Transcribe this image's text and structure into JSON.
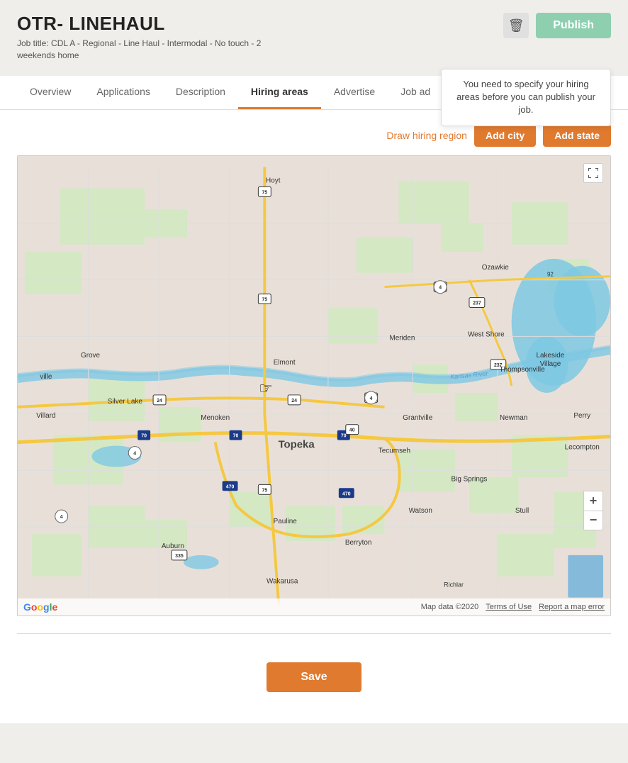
{
  "header": {
    "title": "OTR- LINEHAUL",
    "job_title": "Job title: CDL A - Regional - Line Haul - Intermodal - No touch - 2 weekends home",
    "delete_label": "🗑",
    "publish_label": "Publish",
    "tooltip": "You need to specify your hiring areas before you can publish your job."
  },
  "nav": {
    "tabs": [
      {
        "label": "Overview",
        "active": false
      },
      {
        "label": "Applications",
        "active": false
      },
      {
        "label": "Description",
        "active": false
      },
      {
        "label": "Hiring areas",
        "active": true
      },
      {
        "label": "Advertise",
        "active": false
      },
      {
        "label": "Job ad",
        "active": false
      }
    ]
  },
  "map_controls": {
    "draw_region_label": "Draw hiring region",
    "add_city_label": "Add city",
    "add_state_label": "Add state"
  },
  "map": {
    "fullscreen_icon": "⤢",
    "zoom_in": "+",
    "zoom_out": "−",
    "footer_copy": "Map data ©2020",
    "terms": "Terms of Use",
    "report": "Report a map error",
    "richlar": "Richlar"
  },
  "footer": {
    "save_label": "Save"
  }
}
